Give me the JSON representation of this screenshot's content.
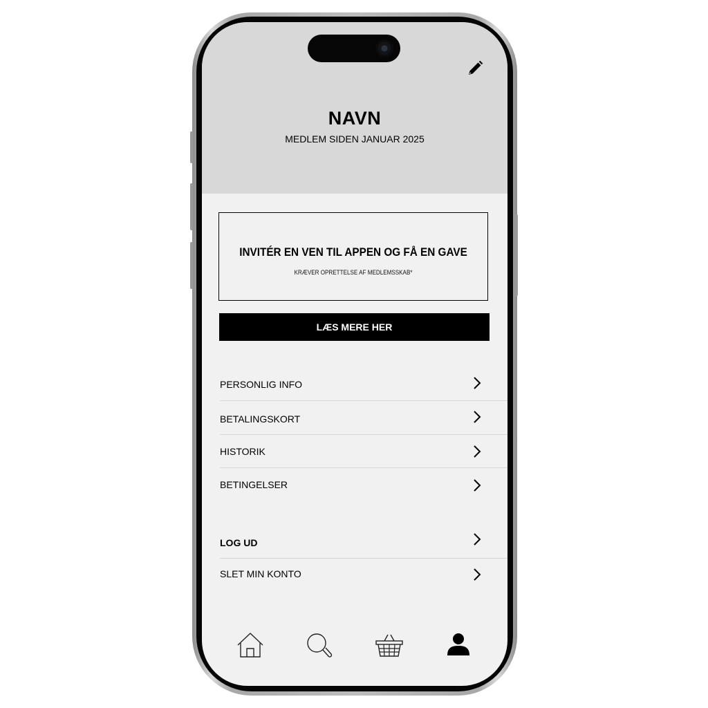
{
  "profile": {
    "name": "NAVN",
    "member_since": "MEDLEM SIDEN JANUAR 2025"
  },
  "invite": {
    "title": "INVITÉR EN VEN TIL APPEN OG FÅ EN GAVE",
    "subtitle": "KRÆVER OPRETTELSE AF MEDLEMSSKAB*",
    "button_label": "LÆS MERE HER"
  },
  "menu": {
    "items": [
      {
        "label": "PERSONLIG INFO"
      },
      {
        "label": "BETALINGSKORT"
      },
      {
        "label": "HISTORIK"
      },
      {
        "label": "BETINGELSER"
      }
    ],
    "account_items": [
      {
        "label": "LOG UD"
      },
      {
        "label": "SLET MIN KONTO"
      }
    ]
  },
  "tabbar": {
    "tabs": [
      {
        "icon": "home-icon"
      },
      {
        "icon": "search-icon"
      },
      {
        "icon": "basket-icon"
      },
      {
        "icon": "profile-icon",
        "active": true
      }
    ]
  },
  "colors": {
    "header_bg": "#d8d8d8",
    "screen_bg": "#f1f1f1",
    "accent": "#000000"
  }
}
